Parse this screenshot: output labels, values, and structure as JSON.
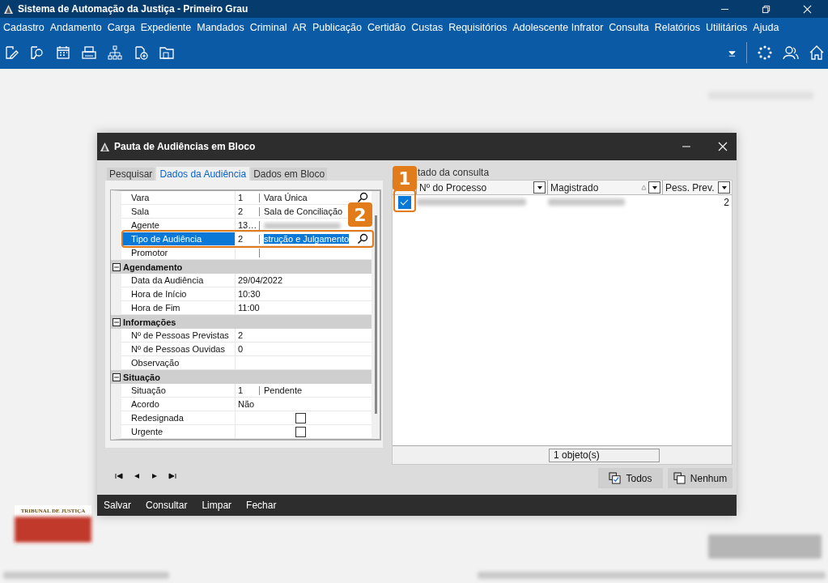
{
  "window": {
    "title": "Sistema de Automação da Justiça - Primeiro Grau"
  },
  "menu": [
    "Cadastro",
    "Andamento",
    "Carga",
    "Expediente",
    "Mandados",
    "Criminal",
    "AR",
    "Publicação",
    "Certidão",
    "Custas",
    "Requisitórios",
    "Adolescente Infrator",
    "Consulta",
    "Relatórios",
    "Utilitários",
    "Ajuda"
  ],
  "background": {
    "logo_text": "TRIBUNAL DE JUSTIÇA"
  },
  "dialog": {
    "title": "Pauta de Audiências em Bloco",
    "tabs": [
      {
        "label": "Pesquisar",
        "selected": false
      },
      {
        "label": "Dados da Audiência",
        "selected": true
      },
      {
        "label": "Dados em Bloco",
        "selected": false
      }
    ],
    "grid": [
      {
        "kind": "field",
        "label": "Vara",
        "code": "1",
        "value": "Vara Única",
        "lookup": true,
        "selected": false
      },
      {
        "kind": "field",
        "label": "Sala",
        "code": "2",
        "value": "Sala de Conciliação",
        "lookup": false,
        "selected": false
      },
      {
        "kind": "field",
        "label": "Agente",
        "code": "13…",
        "redacted": true,
        "lookup": false,
        "selected": false
      },
      {
        "kind": "field",
        "label": "Tipo de Audiência",
        "code": "2",
        "value": "strução e Julgamento",
        "lookup": true,
        "selected": true
      },
      {
        "kind": "field",
        "label": "Promotor",
        "lookup": false,
        "selected": false
      },
      {
        "kind": "group",
        "label": "Agendamento",
        "expanded": true
      },
      {
        "kind": "plain",
        "label": "Data da Audiência",
        "value": "29/04/2022"
      },
      {
        "kind": "plain",
        "label": "Hora de Início",
        "value": "10:30"
      },
      {
        "kind": "plain",
        "label": "Hora de Fim",
        "value": "11:00"
      },
      {
        "kind": "group",
        "label": "Informações",
        "expanded": true
      },
      {
        "kind": "plain",
        "label": "Nº de Pessoas Previstas",
        "value": "2"
      },
      {
        "kind": "plain",
        "label": "Nº de Pessoas Ouvidas",
        "value": "0"
      },
      {
        "kind": "plain",
        "label": "Observação"
      },
      {
        "kind": "group",
        "label": "Situação",
        "expanded": true
      },
      {
        "kind": "field",
        "label": "Situação",
        "code": "1",
        "value": "Pendente",
        "lookup": false,
        "selected": false
      },
      {
        "kind": "plain",
        "label": "Acordo",
        "value": "Não"
      },
      {
        "kind": "checkbox",
        "label": "Redesignada",
        "checked": false
      },
      {
        "kind": "checkbox",
        "label": "Urgente",
        "checked": false
      }
    ],
    "results": {
      "label": "tado da consulta",
      "columns": [
        "Nº do Processo",
        "Magistrado",
        "Pess. Prev."
      ],
      "rows": [
        {
          "checked": true,
          "redacted": true,
          "pess_prev": "2"
        }
      ],
      "status": "1 objeto(s)",
      "buttons": [
        "Todos",
        "Nenhum"
      ]
    },
    "actions": [
      "Salvar",
      "Consultar",
      "Limpar",
      "Fechar"
    ]
  },
  "annotations": [
    "1",
    "2"
  ]
}
